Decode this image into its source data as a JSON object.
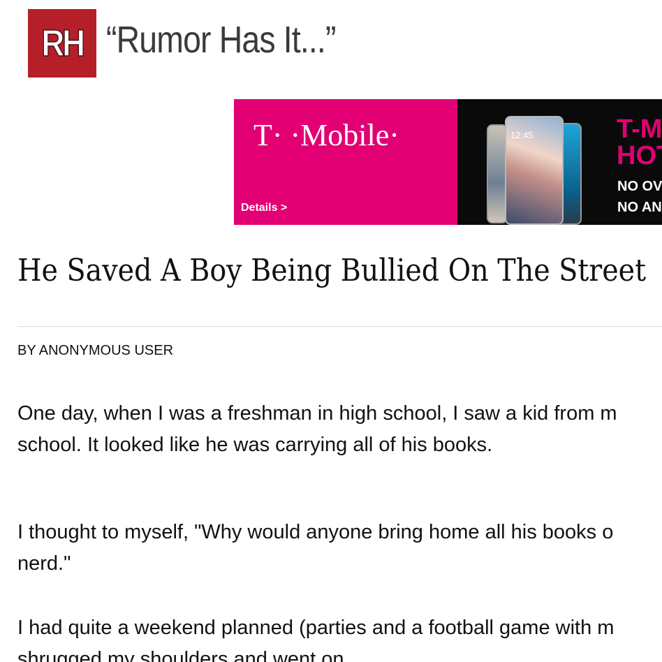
{
  "header": {
    "logo_text": "RH",
    "site_name": "“Rumor Has It...”"
  },
  "ad": {
    "brand": "T· ·Mobile·",
    "details_link": "Details >",
    "headline": [
      "T-M",
      "HOT"
    ],
    "subtext": [
      "NO OV",
      "NO AN"
    ],
    "phone_time": "12:45",
    "colors": {
      "magenta": "#e20074",
      "dark": "#0a0a0a"
    }
  },
  "article": {
    "title": "He Saved A Boy Being Bullied On The Street",
    "byline": "BY ANONYMOUS USER",
    "paragraphs": [
      {
        "lines": [
          "One day, when I was a freshman in high school, I saw a kid from m",
          "school. It looked like he was carrying all of his books."
        ]
      },
      {
        "lines": [
          "I thought to myself, \"Why would anyone bring home all his books o",
          "nerd.\""
        ]
      },
      {
        "lines": [
          "I had quite a weekend planned (parties and a football game with m",
          "shrugged my shoulders and went on."
        ]
      }
    ]
  },
  "colors": {
    "brand_red": "#b51f2a"
  }
}
